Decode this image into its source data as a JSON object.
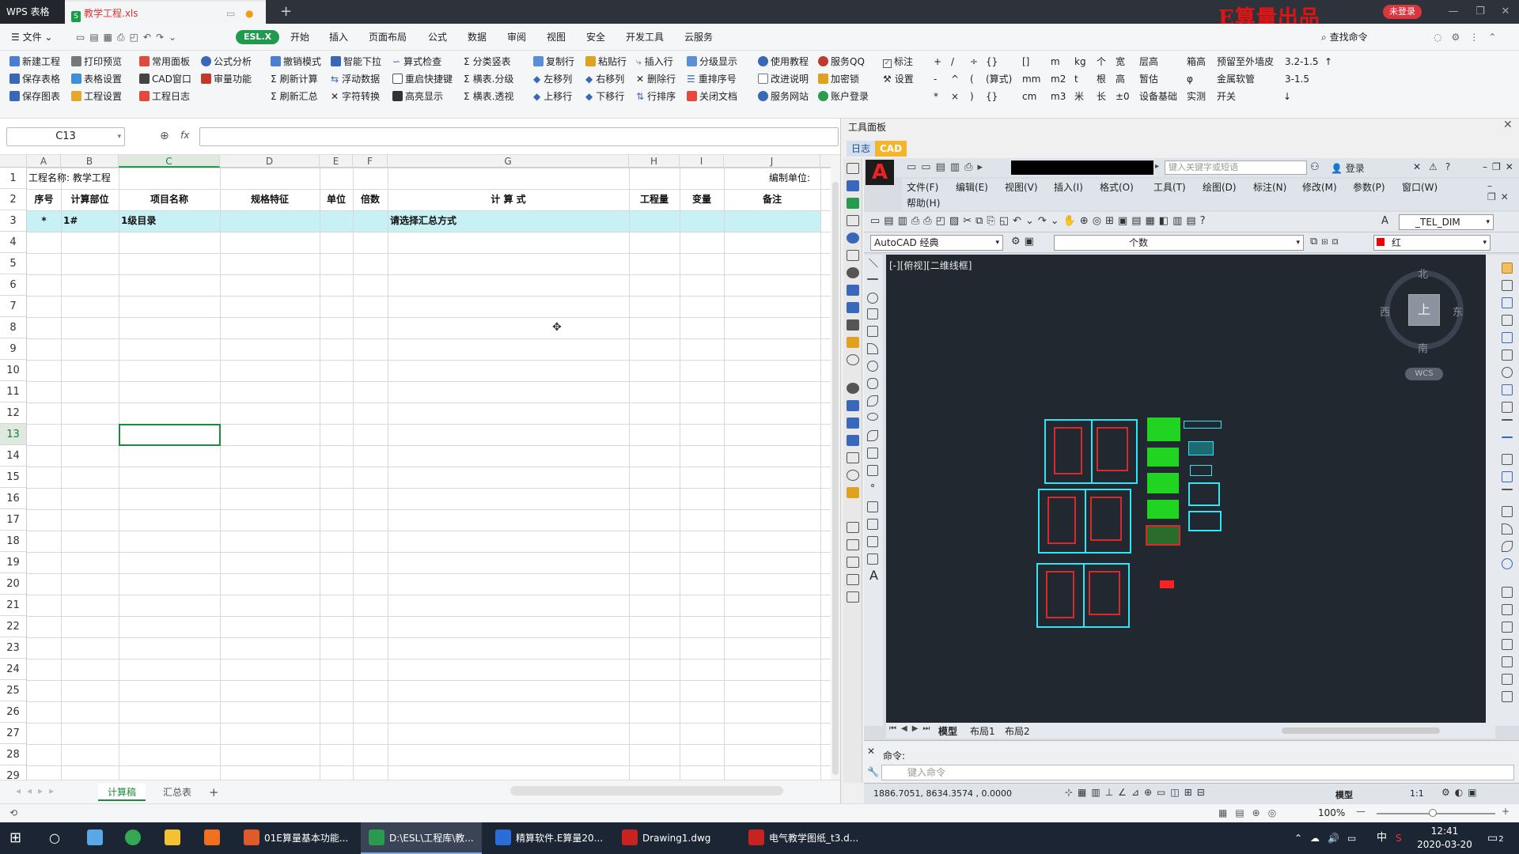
{
  "titlebar": {
    "wps_tab": "WPS 表格",
    "doc_tab": "教学工程.xls",
    "brand": "E算量出品",
    "not_logged": "未登录"
  },
  "menubar": {
    "file": "文件",
    "esl": "ESL.X",
    "items": [
      "开始",
      "插入",
      "页面布局",
      "公式",
      "数据",
      "审阅",
      "视图",
      "安全",
      "开发工具",
      "云服务"
    ],
    "search": "查找命令"
  },
  "ribbon": {
    "col1": [
      "新建工程",
      "保存表格",
      "保存图表"
    ],
    "col2": [
      "打印预览",
      "表格设置",
      "工程设置"
    ],
    "col3": [
      "常用面板",
      "CAD窗口",
      "工程日志"
    ],
    "col4": [
      "公式分析",
      "审量功能"
    ],
    "col5": [
      "撤销模式",
      "刷新计算",
      "刷新汇总"
    ],
    "col6": [
      "智能下拉",
      "浮动数据",
      "字符转换"
    ],
    "col7": [
      "算式检查",
      "重启快捷键",
      "高亮显示"
    ],
    "col8": [
      "分类竖表",
      "横表.分级",
      "横表.透视"
    ],
    "col9": [
      "复制行",
      "左移列",
      "上移行"
    ],
    "col10": [
      "粘贴行",
      "右移列",
      "下移行"
    ],
    "col11": [
      "插入行",
      "删除行",
      "行排序"
    ],
    "col12": [
      "分级显示",
      "重排序号",
      "关闭文档"
    ],
    "col13": [
      "使用教程",
      "改进说明",
      "服务网站"
    ],
    "col14": [
      "服务QQ",
      "加密锁",
      "账户登录"
    ],
    "mark": "标注",
    "settings": "设置",
    "sym_row1": [
      "+",
      "/",
      "÷",
      "{}",
      "[]",
      "m",
      "kg",
      "个",
      "宽",
      "层高",
      "箱高",
      "预留至外墙皮",
      "3.2-1.5",
      "↑"
    ],
    "sym_row2": [
      "-",
      "^",
      "(",
      "(算式)",
      "mm",
      "m2",
      "t",
      "根",
      "高",
      "暂估",
      "φ",
      "金属软管",
      "3-1.5"
    ],
    "sym_row3": [
      "*",
      "×",
      ")",
      "{}",
      "cm",
      "m3",
      "米",
      "长",
      "±0",
      "设备基础",
      "实测",
      "开关",
      "↓"
    ]
  },
  "formula_bar": {
    "cell_ref": "C13",
    "fx": "fx",
    "value": ""
  },
  "sheet": {
    "columns": [
      "A",
      "B",
      "C",
      "D",
      "E",
      "F",
      "G",
      "H",
      "I",
      "J"
    ],
    "rows": [
      "1",
      "2",
      "3",
      "4",
      "5",
      "6",
      "7",
      "8",
      "9",
      "10",
      "11",
      "12",
      "13",
      "14",
      "15",
      "16",
      "17",
      "18",
      "19",
      "20",
      "21",
      "22",
      "23",
      "24",
      "25",
      "26",
      "27",
      "28",
      "29"
    ],
    "row1": {
      "project": "工程名称: 教学工程",
      "unit": "编制单位:"
    },
    "headers": [
      "序号",
      "计算部位",
      "项目名称",
      "规格特征",
      "单位",
      "倍数",
      "计 算 式",
      "工程量",
      "变量",
      "备注"
    ],
    "row3": {
      "seq": "*",
      "part": "1#",
      "name": "1级目录",
      "formula": "请选择汇总方式"
    }
  },
  "sheet_tabs": [
    "计算稿",
    "汇总表",
    "+"
  ],
  "panel": {
    "title": "工具面板",
    "tab_log": "日志",
    "tab_cad": "CAD"
  },
  "cad": {
    "keyword_placeholder": "键入关键字或短语",
    "login": "登录",
    "menu_row1": [
      "文件(F)",
      "编辑(E)",
      "视图(V)",
      "插入(I)",
      "格式(O)",
      "工具(T)",
      "绘图(D)",
      "标注(N)",
      "修改(M)",
      "参数(P)",
      "窗口(W)"
    ],
    "menu_row2": [
      "帮助(H)"
    ],
    "workspace": "AutoCAD 经典",
    "layer": "个数",
    "color": "红",
    "dim_style": "_TEL_DIM",
    "viewport_label": "[-][俯视][二维线框]",
    "compass": {
      "north": "北",
      "south": "南",
      "east": "东",
      "west": "西",
      "top": "上"
    },
    "wcs": "WCS",
    "layout_tabs": [
      "模型",
      "布局1",
      "布局2"
    ],
    "command_label": "命令:",
    "command_placeholder": "键入命令",
    "coords": "1886.7051,   8634.3574 ,  0.0000",
    "model": "模型",
    "scale": "1:1"
  },
  "statusbar": {
    "zoom": "100%"
  },
  "taskbar": {
    "items": [
      "01E算量基本功能...",
      "D:\\ESL\\工程库\\教...",
      "精算软件.E算量20...",
      "Drawing1.dwg",
      "电气教学图纸_t3.d..."
    ],
    "ime": "中",
    "time": "12:41",
    "date": "2020-03-20",
    "notif_count": "2"
  }
}
